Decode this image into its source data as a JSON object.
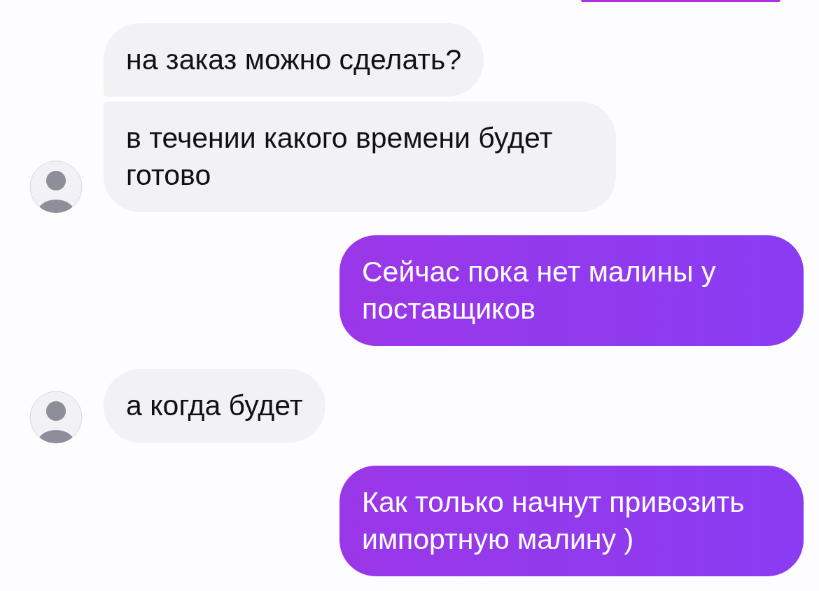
{
  "groups": [
    {
      "kind": "incoming",
      "messages": [
        "на заказ можно сделать?",
        "в течении какого времени будет готово"
      ]
    },
    {
      "kind": "outgoing",
      "messages": [
        "Сейчас пока нет малины у поставщиков"
      ]
    },
    {
      "kind": "incoming",
      "messages": [
        "а когда будет"
      ]
    },
    {
      "kind": "outgoing",
      "messages": [
        "Как только начнут привозить импортную малину )"
      ]
    }
  ]
}
